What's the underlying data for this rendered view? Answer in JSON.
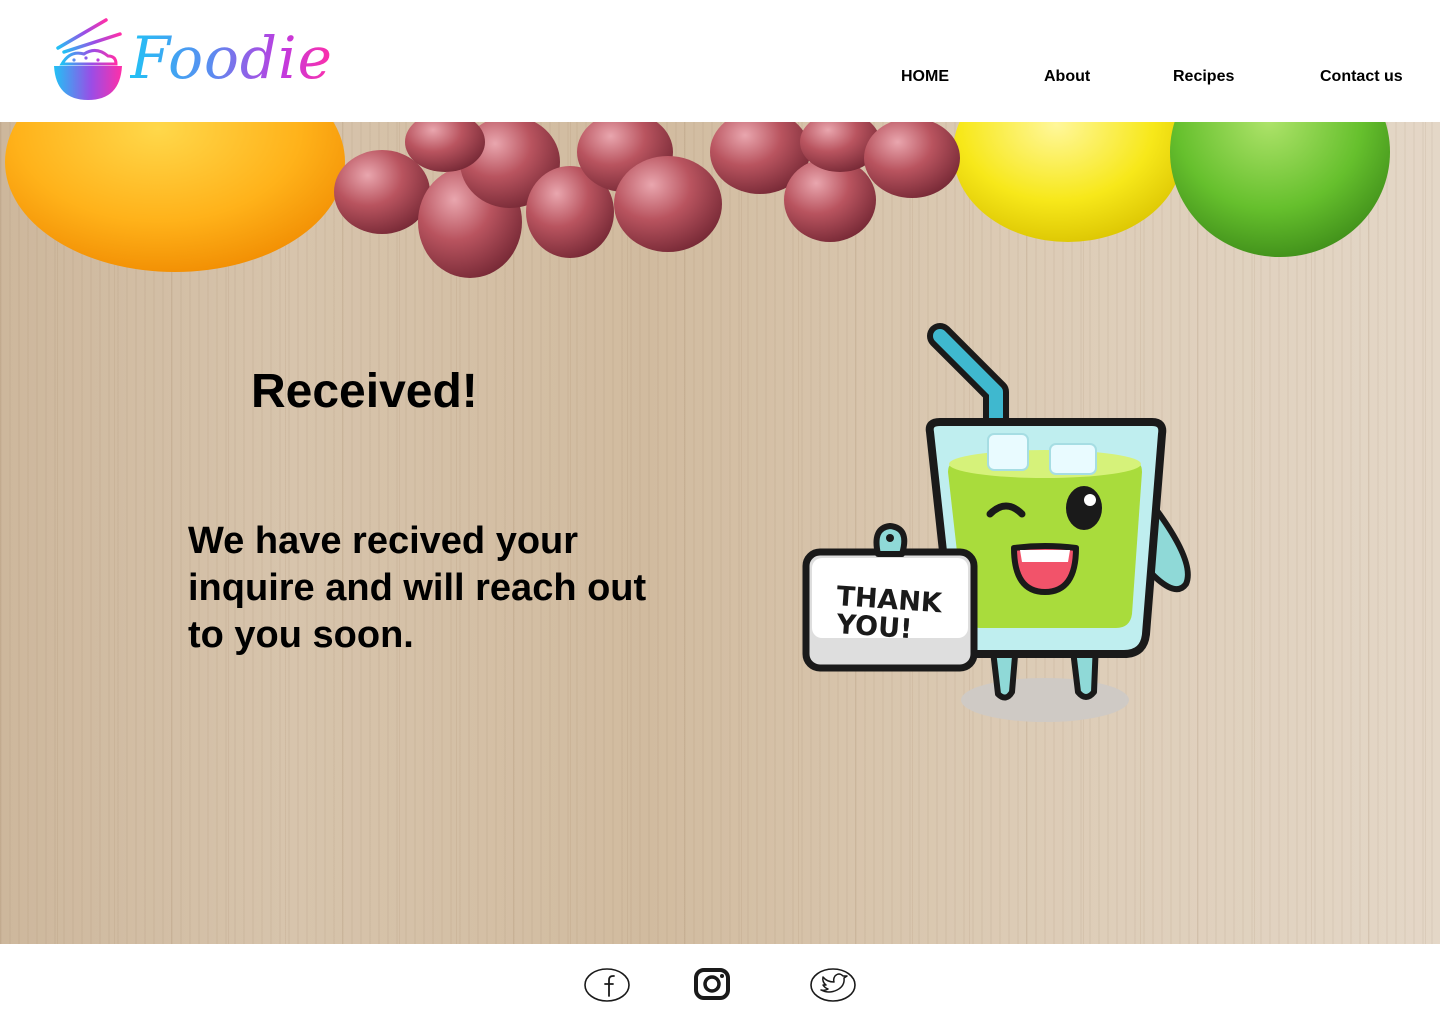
{
  "brand": {
    "name": "Foodie"
  },
  "nav": {
    "home": "HOME",
    "about": "About",
    "recipes": "Recipes",
    "contact": "Contact us"
  },
  "main": {
    "title": "Received!",
    "message": "We have recived your inquire and will reach out to you soon.",
    "mascot_sign": {
      "line1": "THANK",
      "line2": "YOU!"
    }
  },
  "footer": {
    "social": [
      "facebook-icon",
      "instagram-icon",
      "twitter-icon"
    ]
  },
  "colors": {
    "logo_gradient": [
      "#22c1f5",
      "#c03adf",
      "#ff2fa8"
    ],
    "text": "#000000",
    "background": "#ffffff"
  }
}
